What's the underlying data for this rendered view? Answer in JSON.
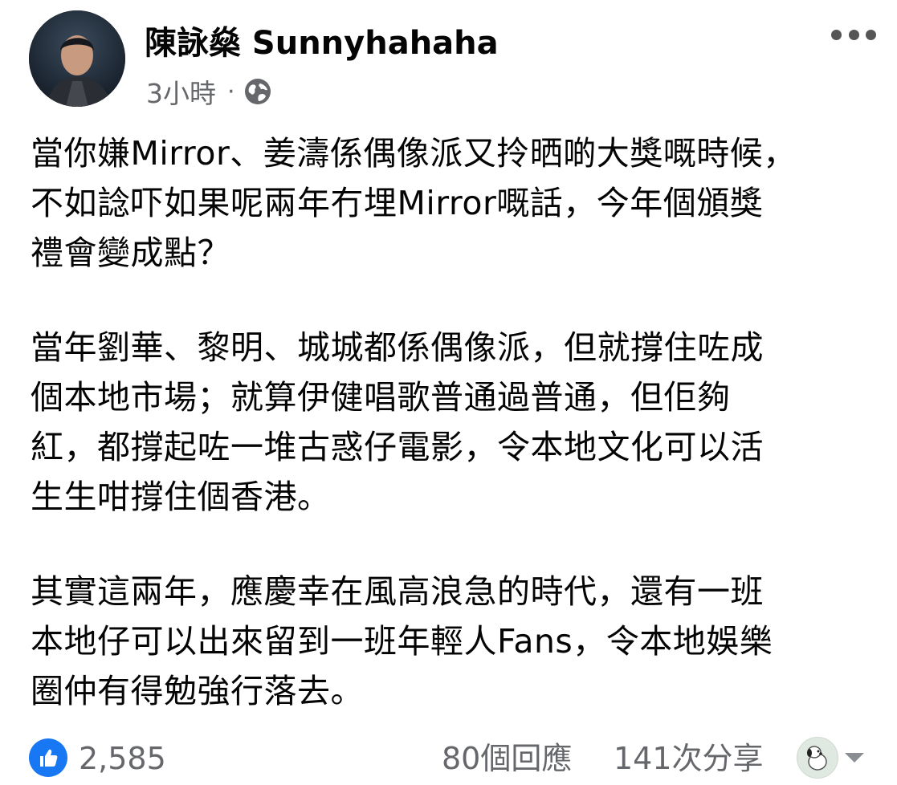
{
  "post": {
    "author": "陳詠燊 Sunnyhahaha",
    "time": "3小時",
    "separator": "·",
    "privacy_icon": "globe-icon",
    "more_icon": "more-dots-icon",
    "paragraphs": [
      [
        "當你嫌Mirror、姜濤係偶像派又拎晒啲大獎嘅時候，",
        "不如諗吓如果呢兩年冇埋Mirror嘅話，今年個頒獎",
        "禮會變成點？"
      ],
      [
        "當年劉華、黎明、城城都係偶像派，但就撐住咗成",
        "個本地市場；就算伊健唱歌普通過普通，但佢夠",
        "紅，都撐起咗一堆古惑仔電影，令本地文化可以活",
        "生生咁撐住個香港。"
      ],
      [
        "其實這兩年，應慶幸在風高浪急的時代，還有一班",
        "本地仔可以出來留到一班年輕人Fans，令本地娛樂",
        "圈仲有得勉強行落去。"
      ]
    ]
  },
  "footer": {
    "like_icon": "thumbs-up-icon",
    "like_count": "2,585",
    "comments": "80個回應",
    "shares": "141次分享",
    "accent_color": "#1877f2"
  }
}
